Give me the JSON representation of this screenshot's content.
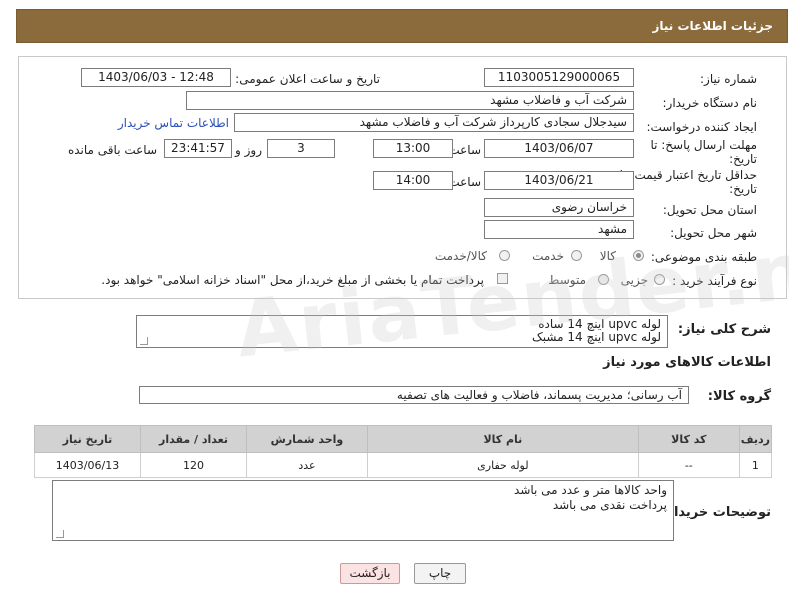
{
  "header": {
    "title": "جزئیات اطلاعات نیاز"
  },
  "form": {
    "need_number_label": "شماره نیاز:",
    "need_number": "1103005129000065",
    "announce_label": "تاریخ و ساعت اعلان عمومی:",
    "announce_value": "1403/06/03 - 12:48",
    "buyer_org_label": "نام دستگاه خریدار:",
    "buyer_org": "شرکت آب و فاضلاب مشهد",
    "requester_label": "ایجاد کننده درخواست:",
    "requester": "سیدجلال سجادی کارپرداز شرکت آب و فاضلاب مشهد",
    "contact_link": "اطلاعات تماس خریدار",
    "reply_deadline_label": "مهلت ارسال پاسخ: تا",
    "reply_deadline_label2": "تاریخ:",
    "reply_date": "1403/06/07",
    "time_label": "ساعت",
    "reply_time": "13:00",
    "days_value": "3",
    "days_label": "روز و",
    "remaining_time": "23:41:57",
    "remaining_label": "ساعت باقی مانده",
    "price_deadline_label": "حداقل تاریخ اعتبار قیمت: تا",
    "price_deadline_label2": "تاریخ:",
    "price_date": "1403/06/21",
    "price_time": "14:00",
    "province_label": "استان محل تحویل:",
    "province": "خراسان رضوی",
    "city_label": "شهر محل تحویل:",
    "city": "مشهد",
    "category_label": "طبقه بندی موضوعی:",
    "category_options": [
      "کالا",
      "خدمت",
      "کالا/خدمت"
    ],
    "category_selected": "کالا",
    "process_label": "نوع فرآیند خرید :",
    "process_options": [
      "جزیی",
      "متوسط"
    ],
    "payment_note": "پرداخت تمام یا بخشی از مبلغ خرید،از محل \"اسناد خزانه اسلامی\" خواهد بود."
  },
  "description": {
    "label": "شرح کلی نیاز:",
    "lines": [
      "لوله upvc اینچ 14 ساده",
      "لوله upvc اینچ 14 مشبک"
    ]
  },
  "goods": {
    "section_title": "اطلاعات کالاهای مورد نیاز",
    "group_label": "گروه کالا:",
    "group_value": "آب رسانی؛ مدیریت پسماند، فاضلاب و فعالیت های تصفیه",
    "columns": [
      "ردیف",
      "کد کالا",
      "نام کالا",
      "واحد شمارش",
      "تعداد / مقدار",
      "تاریخ نیاز"
    ],
    "rows": [
      {
        "row": "1",
        "code": "--",
        "name": "لوله حفاری",
        "unit": "عدد",
        "qty": "120",
        "date": "1403/06/13"
      }
    ]
  },
  "buyer_notes": {
    "label": "توضیحات خریدار:",
    "lines": [
      "واحد کالاها متر و عدد می باشد",
      "پرداخت نقدی می باشد"
    ]
  },
  "buttons": {
    "print": "چاپ",
    "back": "بازگشت"
  },
  "watermark": "AriaTender.neT"
}
